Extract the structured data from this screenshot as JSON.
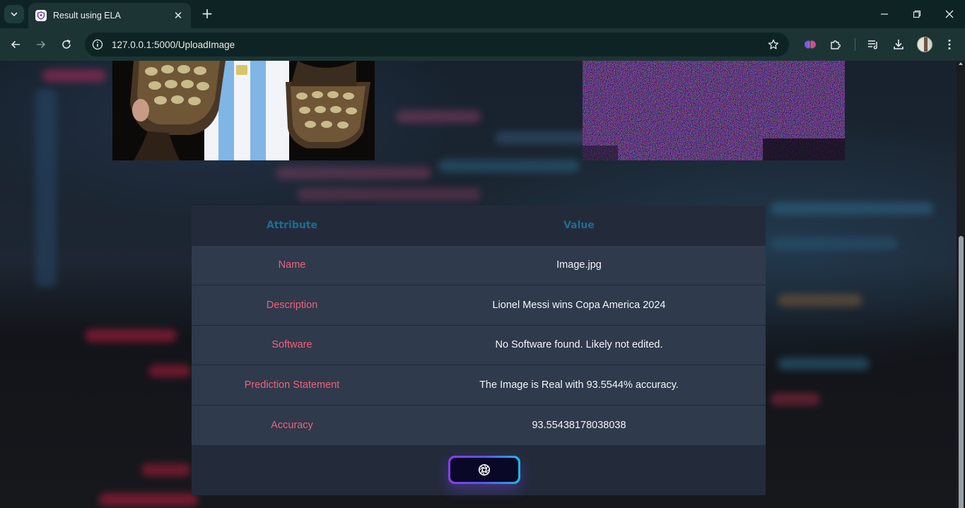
{
  "browser": {
    "tab_title": "Result using ELA",
    "url": "127.0.0.1:5000/UploadImage",
    "icons": {
      "tab_search": "chevron-down-icon",
      "favicon": "shield-icon",
      "close": "close-icon",
      "new_tab": "plus-icon",
      "back": "arrow-left-icon",
      "forward": "arrow-right-icon",
      "reload": "reload-icon",
      "site_info": "info-icon",
      "bookmark": "star-icon",
      "extensions": [
        "brain-extension-icon",
        "puzzle-icon",
        "media-queue-icon",
        "download-icon",
        "avatar",
        "more-vertical-icon"
      ]
    },
    "colors": {
      "frame": "#0e2424",
      "toolbar": "#1d3434"
    }
  },
  "page": {
    "images": [
      {
        "name": "uploaded-image",
        "description_icon": "photo"
      },
      {
        "name": "ela-image",
        "description_icon": "ela-noise"
      }
    ],
    "table": {
      "headers": {
        "attribute": "Attribute",
        "value": "Value"
      },
      "rows": [
        {
          "attribute": "Name",
          "value": "Image.jpg"
        },
        {
          "attribute": "Description",
          "value": "Lionel Messi wins Copa America 2024"
        },
        {
          "attribute": "Software",
          "value": "No Software found. Likely not edited."
        },
        {
          "attribute": "Prediction Statement",
          "value": "The Image is Real with 93.5544% accuracy."
        },
        {
          "attribute": "Accuracy",
          "value": "93.55438178038038"
        }
      ]
    },
    "button_icon": "aperture-icon",
    "colors": {
      "header_text": "#1e6c94",
      "attribute_text": "#f0607a",
      "value_text": "#f3f5f8",
      "card_bg": "#232b3b",
      "row_bg": "#2f3a4c",
      "button_gradient_start": "#8a3bf0",
      "button_gradient_end": "#1fb5e8"
    }
  }
}
